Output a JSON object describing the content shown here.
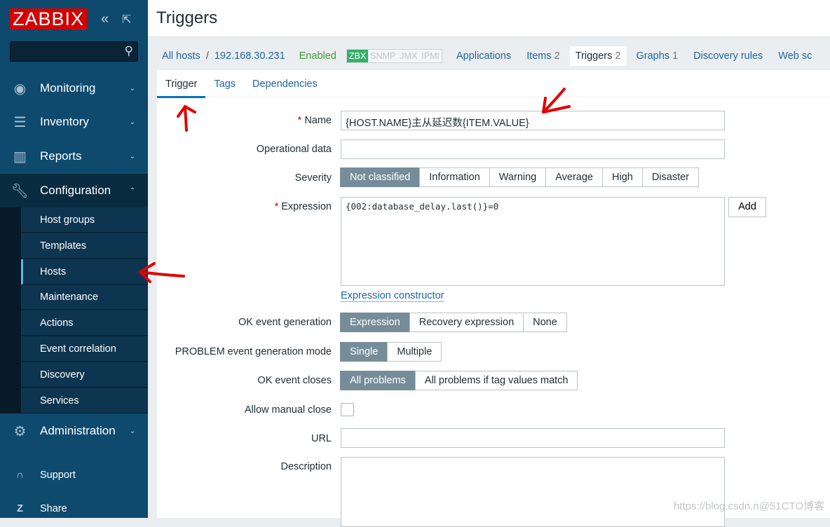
{
  "sidebar": {
    "logo": "ZABBIX",
    "collapse_icon": "double-chevron-left",
    "kiosk_icon": "expand",
    "menu": [
      {
        "label": "Monitoring",
        "icon": "eye"
      },
      {
        "label": "Inventory",
        "icon": "list"
      },
      {
        "label": "Reports",
        "icon": "bar-chart"
      },
      {
        "label": "Configuration",
        "icon": "wrench"
      },
      {
        "label": "Administration",
        "icon": "gear"
      }
    ],
    "config_items": [
      "Host groups",
      "Templates",
      "Hosts",
      "Maintenance",
      "Actions",
      "Event correlation",
      "Discovery",
      "Services"
    ],
    "selected": "Hosts",
    "footer": [
      {
        "label": "Support",
        "icon": "headset"
      },
      {
        "label": "Share",
        "icon": "z"
      }
    ]
  },
  "header": {
    "title": "Triggers"
  },
  "nav": {
    "all_hosts": "All hosts",
    "separator": "/",
    "host": "192.168.30.231",
    "status": "Enabled",
    "protocols": [
      "ZBX",
      "SNMP",
      "JMX",
      "IPMI"
    ],
    "links": [
      {
        "label": "Applications",
        "count": ""
      },
      {
        "label": "Items",
        "count": "2"
      },
      {
        "label": "Triggers",
        "count": "2"
      },
      {
        "label": "Graphs",
        "count": "1"
      },
      {
        "label": "Discovery rules",
        "count": ""
      },
      {
        "label": "Web sc",
        "count": ""
      }
    ]
  },
  "tabs": [
    "Trigger",
    "Tags",
    "Dependencies"
  ],
  "form": {
    "name_label": "Name",
    "name_value": "{HOST.NAME}主从延迟数{ITEM.VALUE}",
    "opdata_label": "Operational data",
    "opdata_value": "",
    "severity_label": "Severity",
    "severity_options": [
      "Not classified",
      "Information",
      "Warning",
      "Average",
      "High",
      "Disaster"
    ],
    "severity_selected": "Not classified",
    "expression_label": "Expression",
    "expression_value": "{002:database_delay.last()}=0",
    "add_label": "Add",
    "constructor_link": "Expression constructor",
    "okgen_label": "OK event generation",
    "okgen_options": [
      "Expression",
      "Recovery expression",
      "None"
    ],
    "mode_label": "PROBLEM event generation mode",
    "mode_options": [
      "Single",
      "Multiple"
    ],
    "closes_label": "OK event closes",
    "closes_options": [
      "All problems",
      "All problems if tag values match"
    ],
    "manual_label": "Allow manual close",
    "manual_checked": false,
    "url_label": "URL",
    "url_value": "",
    "desc_label": "Description",
    "desc_value": "",
    "required_mark": "*"
  },
  "watermark": "https://blog.csdn.n@51CTO博客",
  "colors": {
    "sidebar": "#0e4a6e",
    "logo": "#d40000",
    "active_button": "#768d99",
    "link": "#1f65a6",
    "enabled": "#3c9a38"
  }
}
